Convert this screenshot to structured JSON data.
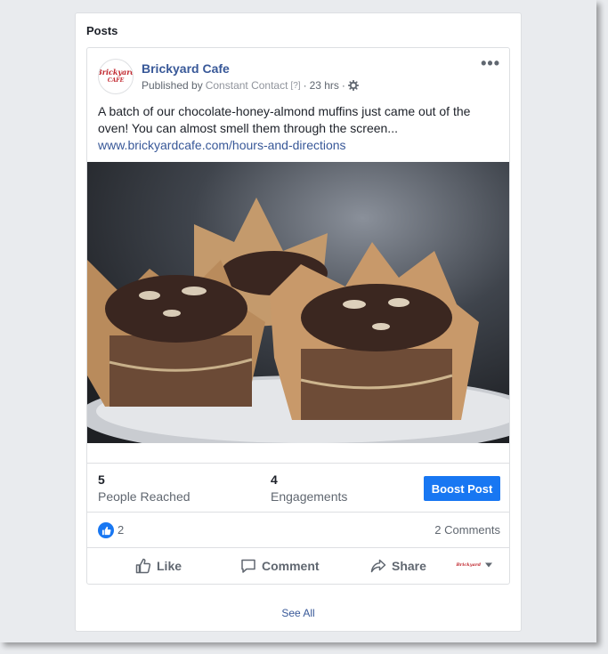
{
  "section": {
    "title": "Posts",
    "see_all": "See All"
  },
  "post": {
    "page_name": "Brickyard Cafe",
    "avatar_text": "Brickyard CAFE",
    "published_by_prefix": "Published by",
    "publisher": "Constant Contact",
    "help_marker": "[?]",
    "separator": "·",
    "time": "23 hrs",
    "text": "A batch of our chocolate-honey-almond muffins just came out of the oven! You can almost smell them through the screen...",
    "link": "www.brickyardcafe.com/hours-and-directions",
    "image_icon": "muffins-photo",
    "more_icon": "more-options-icon"
  },
  "stats": {
    "reached_value": "5",
    "reached_label": "People Reached",
    "engagements_value": "4",
    "engagements_label": "Engagements",
    "boost_label": "Boost Post"
  },
  "reactions": {
    "like_count": "2",
    "comments": "2 Comments"
  },
  "actions": {
    "like": "Like",
    "comment": "Comment",
    "share": "Share"
  },
  "colors": {
    "brand_blue": "#1877f2",
    "link_blue": "#385898",
    "logo_red": "#c0262d"
  }
}
